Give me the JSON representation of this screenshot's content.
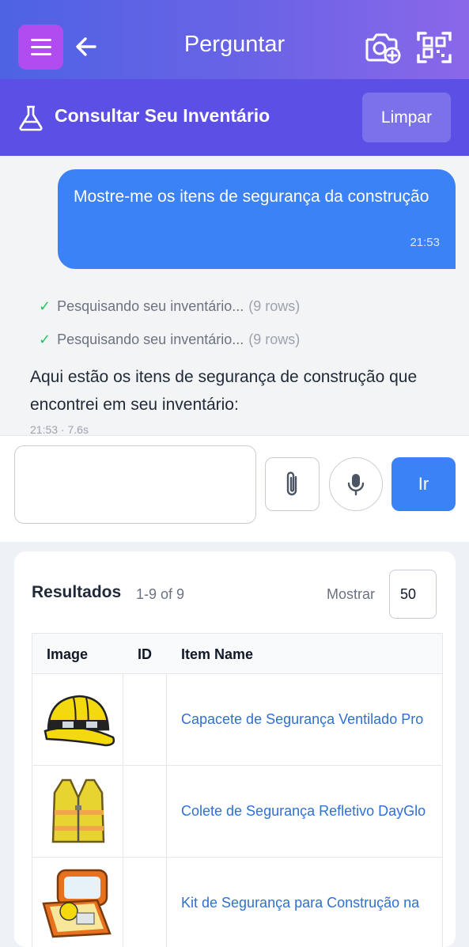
{
  "header": {
    "title": "Perguntar",
    "menu_icon": "hamburger-icon",
    "back_icon": "arrow-left-icon",
    "camera_icon": "camera-add-icon",
    "qr_icon": "qr-scan-icon",
    "accent": "#b14cf0"
  },
  "subheader": {
    "title": "Consultar Seu Inventário",
    "icon": "flask-icon",
    "clear_label": "Limpar",
    "background": "#5b4fe6"
  },
  "chat": {
    "user_message": "Mostre-me os itens de segurança da construção",
    "user_time": "21:53",
    "statuses": [
      {
        "text": "Pesquisando seu inventário...",
        "rows": "(9 rows)"
      },
      {
        "text": "Pesquisando seu inventário...",
        "rows": "(9 rows)"
      }
    ],
    "answer": "Aqui estão os itens de segurança de construção que encontrei em seu inventário:",
    "answer_meta": "21:53 · 7.6s"
  },
  "composer": {
    "input_value": "",
    "attach_icon": "paperclip-icon",
    "mic_icon": "microphone-icon",
    "go_label": "Ir",
    "go_color": "#3b82f6"
  },
  "results": {
    "title": "Resultados",
    "count": "1-9 of 9",
    "show_label": "Mostrar",
    "show_value": "50",
    "columns": [
      "Image",
      "ID",
      "Item Name"
    ],
    "rows": [
      {
        "image": "hard-hat-image",
        "id": "",
        "name": "Capacete de Segurança Ventilado Pro"
      },
      {
        "image": "safety-vest-image",
        "id": "",
        "name": "Colete de Segurança Refletivo DayGlo"
      },
      {
        "image": "safety-kit-image",
        "id": "",
        "name": "Kit de Segurança para Construção na"
      }
    ]
  }
}
